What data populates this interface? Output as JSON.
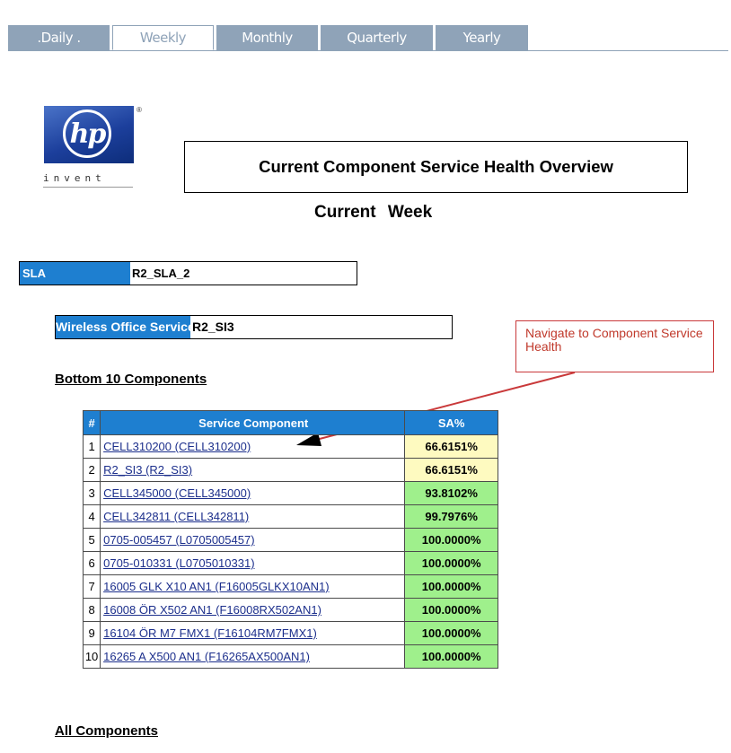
{
  "tabs": [
    {
      "label": ".Daily .",
      "active": false
    },
    {
      "label": "Weekly",
      "active": true
    },
    {
      "label": "Monthly",
      "active": false
    },
    {
      "label": "Quarterly",
      "active": false
    },
    {
      "label": "Yearly",
      "active": false
    }
  ],
  "logo": {
    "mark": "hp",
    "tagline": "invent",
    "registered": "®"
  },
  "title": "Current Component Service Health Overview",
  "subtitle": "Current Week",
  "sla": {
    "label": "SLA",
    "value": "R2_SLA_2"
  },
  "service": {
    "label": "Wireless Office Service",
    "value": "R2_SI3"
  },
  "callout": "Navigate to Component Service Health",
  "bottom_heading": "Bottom 10 Components",
  "all_heading": "All Components",
  "table": {
    "headers": [
      "#",
      "Service Component",
      "SA%"
    ],
    "rows": [
      {
        "num": "1",
        "name": "CELL310200 (CELL310200)",
        "sa": "66.6151%",
        "status": "yellow"
      },
      {
        "num": "2",
        "name": "R2_SI3 (R2_SI3)",
        "sa": "66.6151%",
        "status": "yellow"
      },
      {
        "num": "3",
        "name": "CELL345000 (CELL345000)",
        "sa": "93.8102%",
        "status": "green"
      },
      {
        "num": "4",
        "name": "CELL342811 (CELL342811)",
        "sa": "99.7976%",
        "status": "green"
      },
      {
        "num": "5",
        "name": "0705-005457 (L0705005457)",
        "sa": "100.0000%",
        "status": "green"
      },
      {
        "num": "6",
        "name": "0705-010331 (L0705010331)",
        "sa": "100.0000%",
        "status": "green"
      },
      {
        "num": "7",
        "name": "16005 GLK X10 AN1 (F16005GLKX10AN1)",
        "sa": "100.0000%",
        "status": "green"
      },
      {
        "num": "8",
        "name": "16008 ÖR X502 AN1 (F16008RX502AN1)",
        "sa": "100.0000%",
        "status": "green"
      },
      {
        "num": "9",
        "name": "16104 ÖR M7 FMX1 (F16104RM7FMX1)",
        "sa": "100.0000%",
        "status": "green"
      },
      {
        "num": "10",
        "name": "16265 A X500 AN1 (F16265AX500AN1)",
        "sa": "100.0000%",
        "status": "green"
      }
    ]
  },
  "colors": {
    "accent": "#1e7fd0",
    "tab": "#8fa3b8",
    "warn": "#fefac0",
    "ok": "#9ff08c",
    "callout": "#c9393a"
  }
}
